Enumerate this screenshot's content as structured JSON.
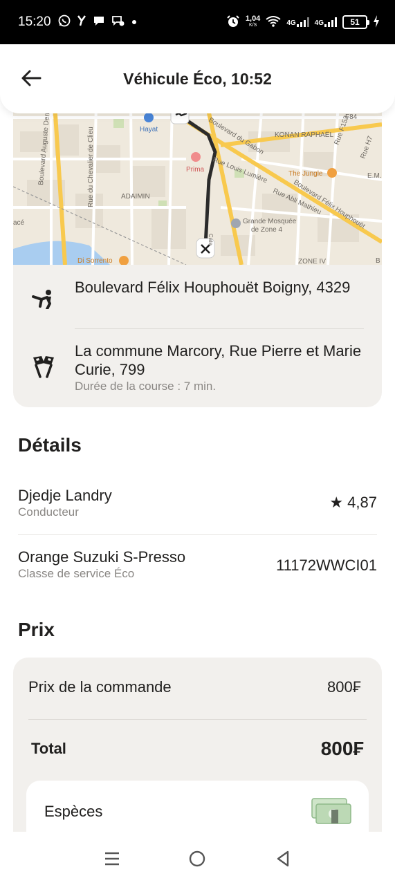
{
  "status_bar": {
    "time": "15:20",
    "speed_value": "1,04",
    "speed_unit": "K/S",
    "network_1": "4G",
    "network_2": "4G",
    "battery": "51"
  },
  "header": {
    "title": "Véhicule Éco, 10:52"
  },
  "map": {
    "labels": {
      "hayat": "Hayat",
      "bd_gabon": "Boulevard du Gabon",
      "konan": "KONAN RAPHAËL",
      "f153": "Rue F153",
      "f84": "F84",
      "h7": "Rue H7",
      "em": "E.M.",
      "jungle": "The Jungle",
      "prima": "Prima",
      "louis_lumiere": "Rue Louis Lumière",
      "abli": "Rue Abli Mathieu",
      "felix": "Boulevard Félix Houphouët",
      "b": "B",
      "mosquee_1": "Grande Mosquée",
      "mosquee_2": "de Zone 4",
      "adaimin": "ADAIMIN",
      "chevalier": "Rue du Chevalier de Clieu",
      "auguste": "Boulevard Auguste Denise",
      "ace": "acé",
      "sorrento": "Di Sorrento",
      "zone4": "ZONE IV",
      "vertical_road": "Cate"
    }
  },
  "route": {
    "pickup_address": "Boulevard Félix Houphouët Boigny, 4329",
    "destination_address": "La commune Marcory, Rue Pierre et Marie Curie, 799",
    "duration": "Durée de la course : 7 min."
  },
  "details": {
    "title": "Détails",
    "driver_name": "Djedje Landry",
    "driver_role": "Conducteur",
    "rating_star": "★",
    "rating": "4,87",
    "car": "Orange Suzuki S-Presso",
    "service_class": "Classe de service Éco",
    "plate": "11172WWCI01"
  },
  "price": {
    "title": "Prix",
    "order_label": "Prix de la commande",
    "order_value": "800₣",
    "total_label": "Total",
    "total_value": "800₣",
    "payment_method": "Espèces"
  },
  "icons": {
    "back": "arrow-left-icon",
    "pickup": "person-waving-icon",
    "destination": "checkered-flags-icon",
    "cash": "banknote-icon",
    "nav_menu": "menu-icon",
    "nav_home": "home-circle-icon",
    "nav_back": "triangle-back-icon"
  },
  "colors": {
    "route_line": "#2b2b2b",
    "map_bg": "#efe9dd",
    "major_road": "#f8c94e",
    "card_bg": "#f2f0ed"
  }
}
